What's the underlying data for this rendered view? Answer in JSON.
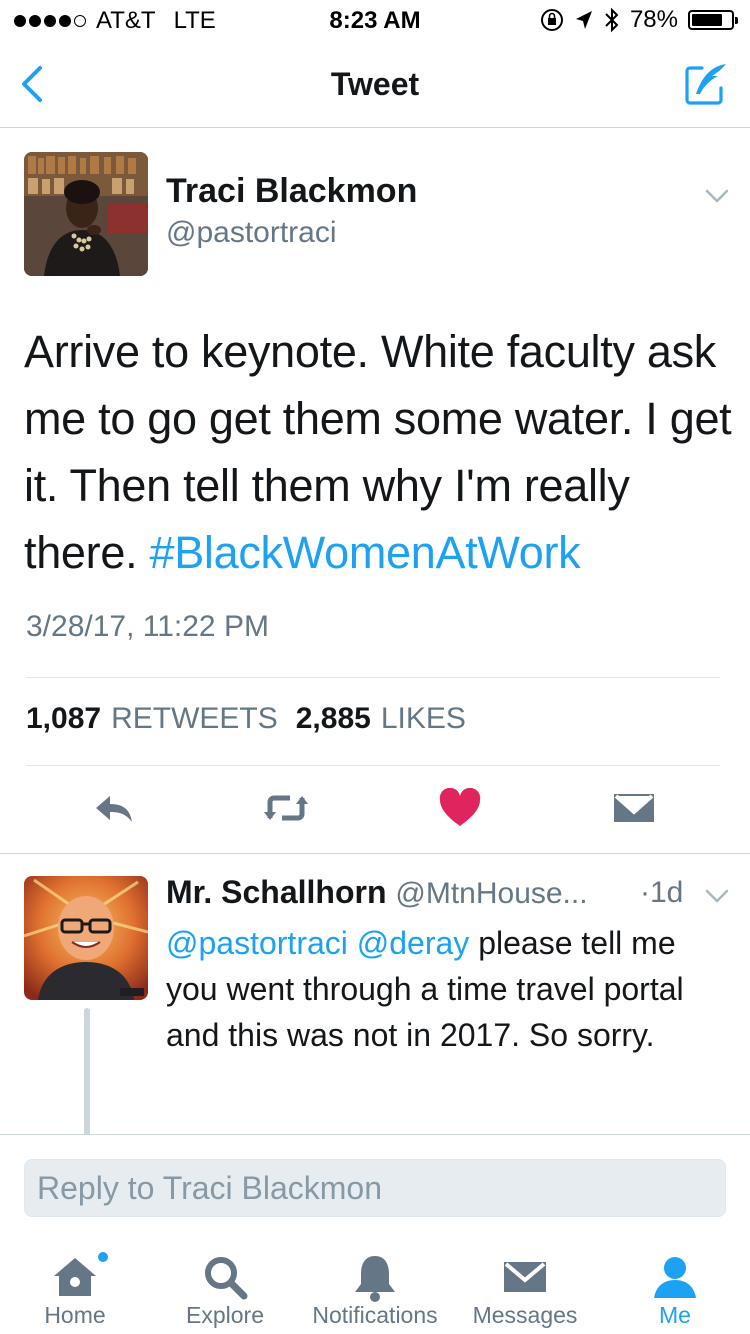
{
  "status_bar": {
    "carrier": "AT&T",
    "network": "LTE",
    "time": "8:23 AM",
    "battery": "78%",
    "battery_level": 0.78,
    "signal_bars_filled": 4,
    "signal_bars_total": 5
  },
  "nav": {
    "title": "Tweet",
    "back_icon": "chevron-left-icon",
    "compose_icon": "compose-quill-icon"
  },
  "tweet": {
    "author_name": "Traci Blackmon",
    "author_handle": "@pastortraci",
    "text": "Arrive to keynote. White faculty ask me to go get them some water. I get it. Then tell them why I'm really there. ",
    "hashtag": "#BlackWomenAtWork",
    "timestamp": "3/28/17, 11:22 PM",
    "retweets_count": "1,087",
    "retweets_label": "RETWEETS",
    "likes_count": "2,885",
    "likes_label": "LIKES"
  },
  "reply": {
    "author_name": "Mr. Schallhorn",
    "author_handle": "@MtnHouse...",
    "time": "·1d",
    "mention_1": "@pastortraci",
    "mention_2": "@deray",
    "text": " please tell me you went through a time travel portal and this was not in 2017. So sorry."
  },
  "composer": {
    "placeholder": "Reply to Traci Blackmon"
  },
  "tabs": [
    {
      "label": "Home",
      "icon": "home-icon"
    },
    {
      "label": "Explore",
      "icon": "search-icon"
    },
    {
      "label": "Notifications",
      "icon": "bell-icon"
    },
    {
      "label": "Messages",
      "icon": "envelope-icon"
    },
    {
      "label": "Me",
      "icon": "person-icon"
    }
  ],
  "colors": {
    "accent": "#1da1f2",
    "like": "#e0245e",
    "muted": "#657786",
    "icon_gray": "#657786"
  }
}
